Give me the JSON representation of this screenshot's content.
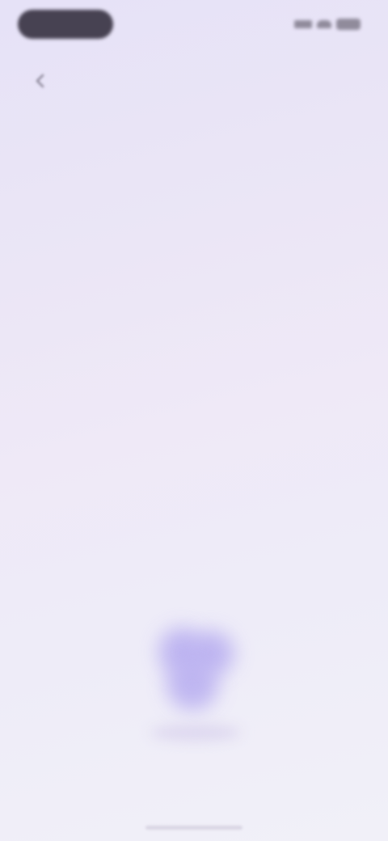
{
  "headline": {
    "text": ""
  },
  "voice_orb": {
    "hint": ""
  },
  "colors": {
    "background": "#ebe6f6",
    "accent": "#b8aef0",
    "status_pill": "#474252",
    "headline_text": "#6a6478"
  },
  "icons": {
    "back": "chevron-left-icon",
    "signal": "signal-icon",
    "wifi": "wifi-icon",
    "battery": "battery-icon",
    "voice": "voice-orb-icon"
  }
}
